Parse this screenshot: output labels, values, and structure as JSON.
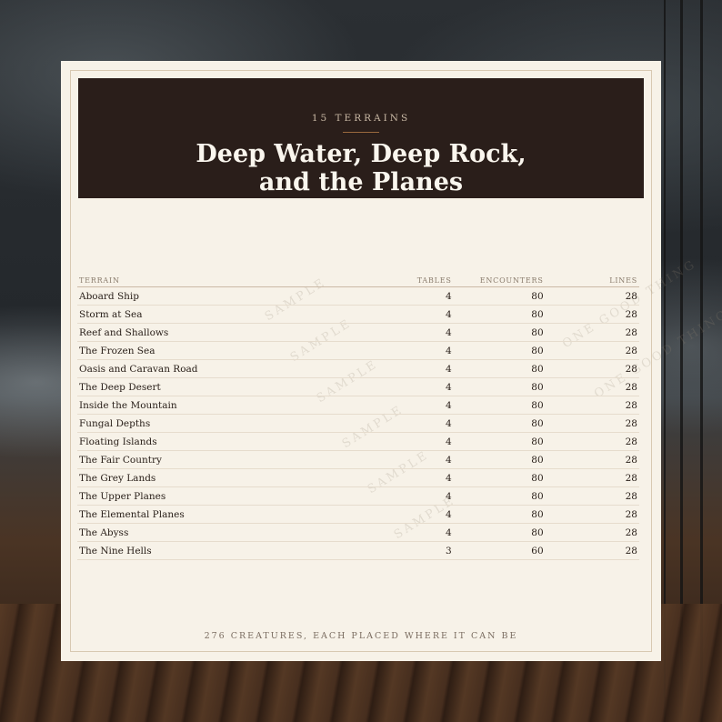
{
  "header": {
    "kicker": "15 TERRAINS",
    "title_line1": "Deep Water, Deep Rock,",
    "title_line2": "and the Planes"
  },
  "table": {
    "columns": [
      "TERRAIN",
      "TABLES",
      "ENCOUNTERS",
      "LINES"
    ],
    "rows": [
      {
        "terrain": "Aboard Ship",
        "tables": "4",
        "encounters": "80",
        "lines": "28"
      },
      {
        "terrain": "Storm at Sea",
        "tables": "4",
        "encounters": "80",
        "lines": "28"
      },
      {
        "terrain": "Reef and Shallows",
        "tables": "4",
        "encounters": "80",
        "lines": "28"
      },
      {
        "terrain": "The Frozen Sea",
        "tables": "4",
        "encounters": "80",
        "lines": "28"
      },
      {
        "terrain": "Oasis and Caravan Road",
        "tables": "4",
        "encounters": "80",
        "lines": "28"
      },
      {
        "terrain": "The Deep Desert",
        "tables": "4",
        "encounters": "80",
        "lines": "28"
      },
      {
        "terrain": "Inside the Mountain",
        "tables": "4",
        "encounters": "80",
        "lines": "28"
      },
      {
        "terrain": "Fungal Depths",
        "tables": "4",
        "encounters": "80",
        "lines": "28"
      },
      {
        "terrain": "Floating Islands",
        "tables": "4",
        "encounters": "80",
        "lines": "28"
      },
      {
        "terrain": "The Fair Country",
        "tables": "4",
        "encounters": "80",
        "lines": "28"
      },
      {
        "terrain": "The Grey Lands",
        "tables": "4",
        "encounters": "80",
        "lines": "28"
      },
      {
        "terrain": "The Upper Planes",
        "tables": "4",
        "encounters": "80",
        "lines": "28"
      },
      {
        "terrain": "The Elemental Planes",
        "tables": "4",
        "encounters": "80",
        "lines": "28"
      },
      {
        "terrain": "The Abyss",
        "tables": "4",
        "encounters": "80",
        "lines": "28"
      },
      {
        "terrain": "The Nine Hells",
        "tables": "3",
        "encounters": "60",
        "lines": "28"
      }
    ]
  },
  "watermark": {
    "sample": "SAMPLE",
    "brand": "ONE GOOD THING"
  },
  "footer": "276 CREATURES, EACH PLACED WHERE IT CAN BE",
  "colors": {
    "header_bg": "#2a1e1a",
    "card_bg": "#f7f2e8",
    "accent_rule": "#9a6a3e"
  }
}
